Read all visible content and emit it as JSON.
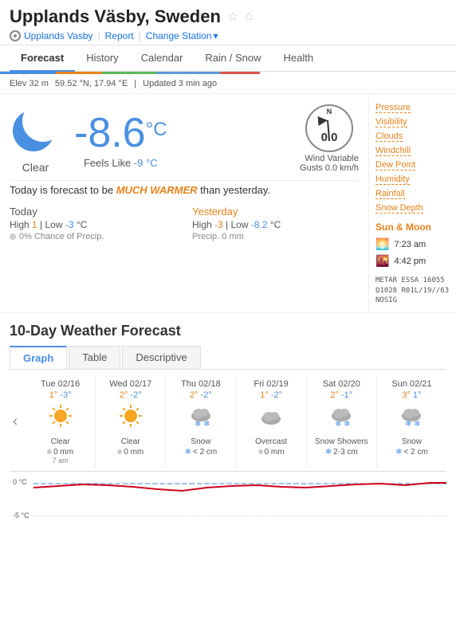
{
  "header": {
    "location": "Upplands Väsby, Sweden",
    "subLocation": "Upplands Vasby",
    "report": "Report",
    "changeStation": "Change Station",
    "elevation": "Elev 32 m",
    "coordinates": "59.52 °N, 17.94 °E",
    "updated": "Updated 3 min ago"
  },
  "tabs": {
    "main": [
      "Forecast",
      "History",
      "Calendar",
      "Rain / Snow",
      "Health"
    ],
    "active": "Forecast"
  },
  "current": {
    "temperature": "-8.6",
    "unit": "°C",
    "condition": "Clear",
    "feelsLike": "Feels Like -9 °C",
    "windLabel": "Wind Variable",
    "gusts": "Gusts 0.0 km/h",
    "windSpeed": "0.0",
    "forecastText1": "Today is forecast to be ",
    "forecastHighlight": "MUCH WARMER",
    "forecastText2": " than yesterday."
  },
  "today": {
    "title": "Today",
    "high": "1",
    "low": "-3",
    "tempUnit": "°C",
    "precip": "0% Chance of Precip."
  },
  "yesterday": {
    "title": "Yesterday",
    "high": "-3",
    "low": "-8.2",
    "tempUnit": "°C",
    "precip": "Precip. 0 mm"
  },
  "sidebar": {
    "sectionTitle": "Sun & Moon",
    "links": [
      "Pressure",
      "Visibility",
      "Clouds",
      "Windchill",
      "Dew Point",
      "Humidity",
      "Rainfall",
      "Snow Depth"
    ],
    "sunrise": "7:23 am",
    "sunset": "4:42 pm",
    "metar": "METAR ESSA 16055\nQ1028 R01L/19//63\nNOSIG"
  },
  "tenDay": {
    "title": "10-Day Weather Forecast",
    "subTabs": [
      "Graph",
      "Table",
      "Descriptive"
    ],
    "activeSubTab": "Graph",
    "navArrow": "‹",
    "days": [
      {
        "date": "Tue 02/16",
        "hi": "1°",
        "lo": "-3°",
        "icon": "☀",
        "desc": "Clear",
        "precip": "0 mm",
        "precipType": "rain",
        "time": "7 am"
      },
      {
        "date": "Wed 02/17",
        "hi": "2°",
        "lo": "-2°",
        "icon": "☀",
        "desc": "Clear",
        "precip": "0 mm",
        "precipType": "rain"
      },
      {
        "date": "Thu 02/18",
        "hi": "2°",
        "lo": "-2°",
        "icon": "🌨",
        "desc": "Snow",
        "precip": "< 2 cm",
        "precipType": "snow"
      },
      {
        "date": "Fri 02/19",
        "hi": "1°",
        "lo": "-2°",
        "icon": "☁",
        "desc": "Overcast",
        "precip": "0 mm",
        "precipType": "rain"
      },
      {
        "date": "Sat 02/20",
        "hi": "2°",
        "lo": "-1°",
        "icon": "🌨",
        "desc": "Snow Showers",
        "precip": "2-3 cm",
        "precipType": "snow"
      },
      {
        "date": "Sun 02/21",
        "hi": "3°",
        "lo": "1°",
        "icon": "🌨",
        "desc": "Snow",
        "precip": "< 2 cm",
        "precipType": "snow"
      }
    ],
    "chartYLabels": [
      "0 °C",
      "-5 °C"
    ]
  }
}
